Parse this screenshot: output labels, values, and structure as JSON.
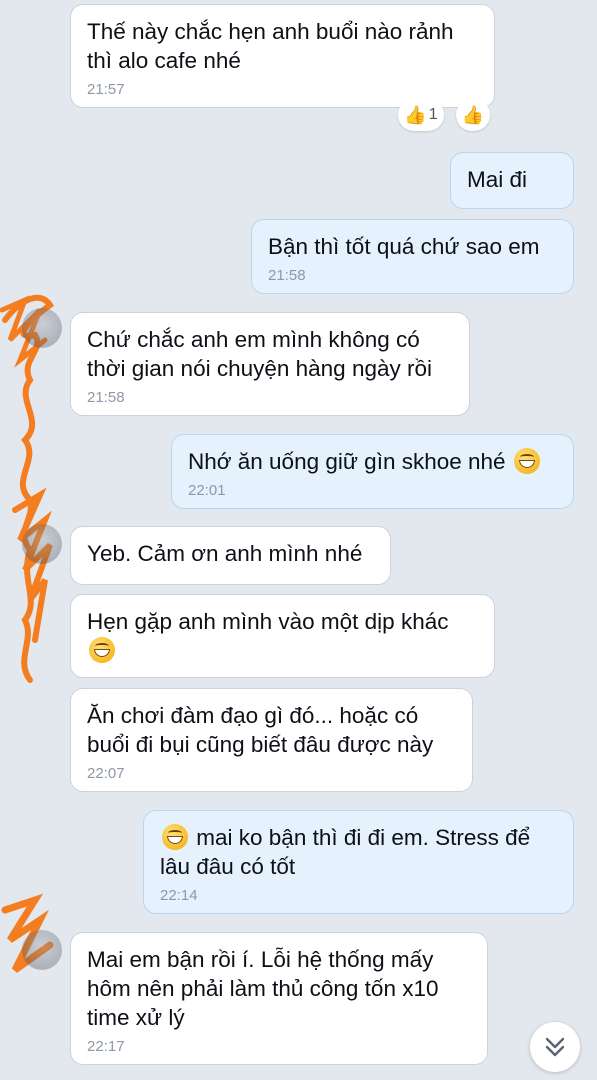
{
  "messages": [
    {
      "id": "m1",
      "side": "in",
      "text": "Thế này chắc hẹn anh buổi nào rảnh thì alo cafe nhé",
      "time": "21:57"
    },
    {
      "id": "m2",
      "side": "out",
      "text": "Mai đi",
      "time": ""
    },
    {
      "id": "m3",
      "side": "out",
      "text": "Bận thì tốt quá chứ sao em",
      "time": "21:58"
    },
    {
      "id": "m4",
      "side": "in",
      "text": "Chứ chắc anh em mình không có thời gian nói chuyện hàng ngày rồi",
      "time": "21:58"
    },
    {
      "id": "m5",
      "side": "out",
      "text": "Nhớ ăn uống giữ gìn skhoe nhé",
      "time": "22:01",
      "emoji_after": "grin-emoji"
    },
    {
      "id": "m6",
      "side": "in",
      "text": "Yeb. Cảm ơn anh mình nhé",
      "time": ""
    },
    {
      "id": "m7",
      "side": "in",
      "text": "Hẹn gặp anh mình vào một dịp khác",
      "time": "",
      "emoji_after": "grin-emoji"
    },
    {
      "id": "m8",
      "side": "in",
      "text": "Ăn chơi đàm đạo gì đó... hoặc có buổi đi bụi cũng biết đâu được này",
      "time": "22:07"
    },
    {
      "id": "m9",
      "side": "out",
      "text": "mai ko bận thì đi đi em. Stress để lâu đâu có tốt",
      "time": "22:14",
      "emoji_before": "grin-emoji"
    },
    {
      "id": "m10",
      "side": "in",
      "text": "Mai em bận rồi í. Lỗi hệ thống mấy hôm nên phải làm thủ công tốn x10 time xử lý",
      "time": "22:17"
    }
  ],
  "reactions": {
    "icon": "thumbs-up-icon",
    "count": "1",
    "add_icon": "thumbs-up-icon"
  },
  "scroll_button": {
    "icon": "chevron-double-down-icon"
  },
  "colors": {
    "background": "#e3e8ef",
    "incoming": "#ffffff",
    "outgoing": "#e5f2fd",
    "scribble": "#f47d20"
  }
}
